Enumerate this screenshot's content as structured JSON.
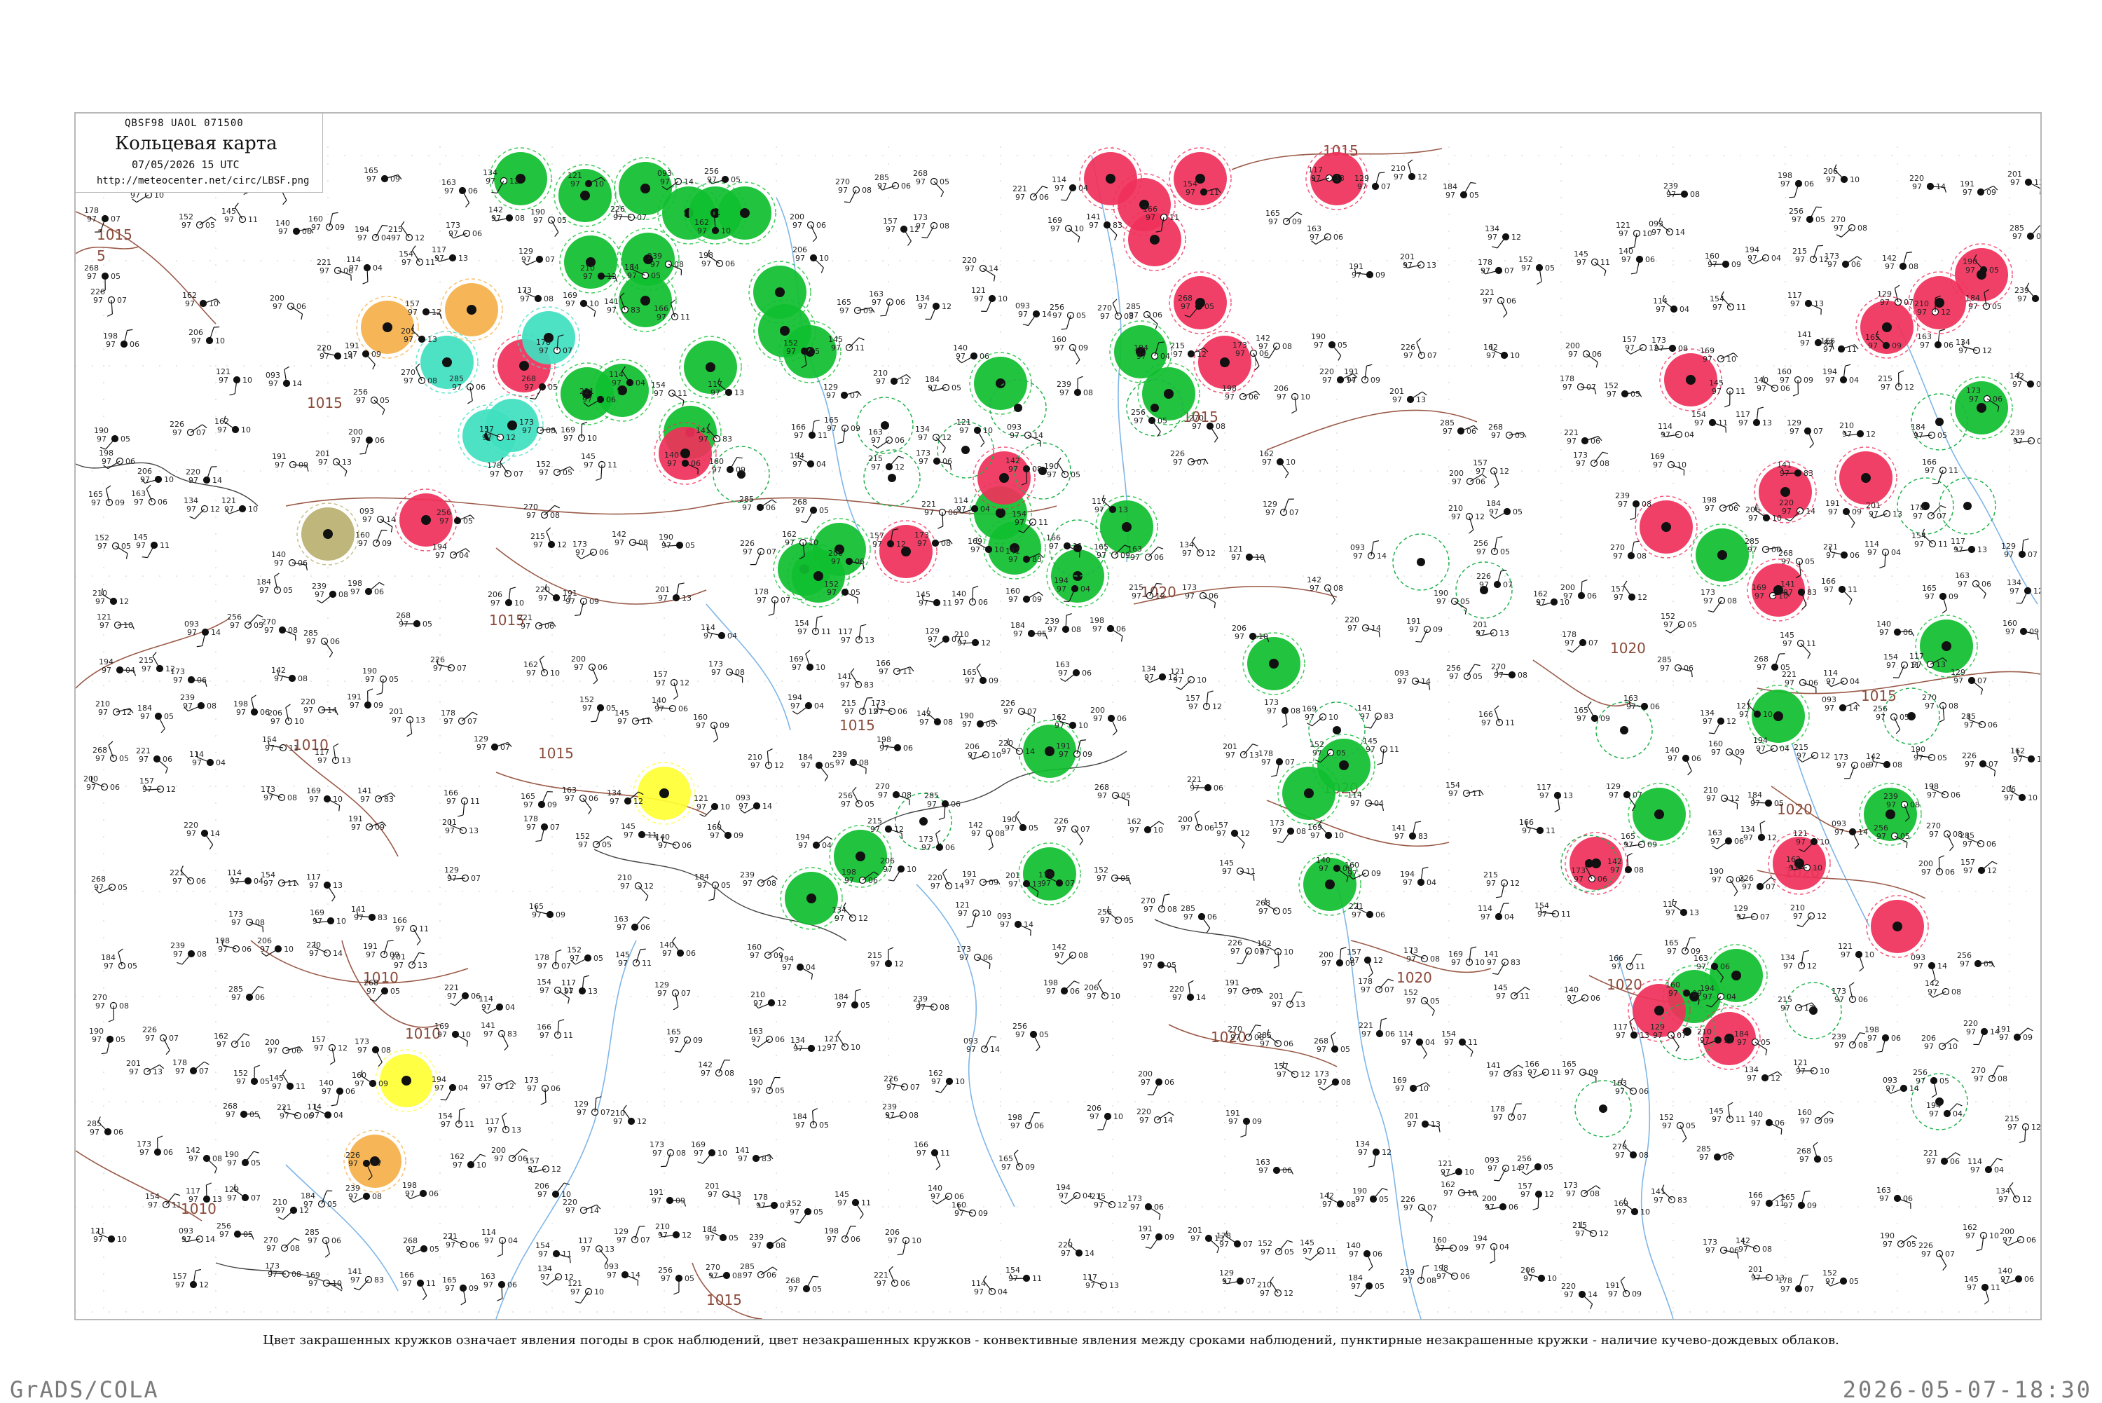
{
  "header": {
    "code": "QBSF98  UAOL  071500",
    "title": "Кольцевая карта",
    "date": "07/05/2026 15 UTC",
    "url": "http://meteocenter.net/circ/LBSF.png"
  },
  "caption": "Цвет закрашенных кружков означает явления погоды в срок наблюдений, цвет незакрашенных кружков - конвективные явления между сроками наблюдений, пунктирные незакрашенные кружки - наличие кучево-дождевых облаков.",
  "footer": {
    "left": "GrADS/COLA",
    "right": "2026-05-07-18:30"
  },
  "colors": {
    "rain_green": "#0fbf2f",
    "thunder_red": "#f0305a",
    "shower_orange": "#f5b04a",
    "fog_yellow": "#ffff33",
    "drizzle_teal": "#3fe0c0",
    "haze_olive": "#b8b070",
    "isobar_brown": "#9a5a48",
    "river_blue": "#7fb6e8",
    "coast_dark": "#444444"
  },
  "isobars": [
    "1015",
    "1015",
    "1015",
    "1015",
    "1015",
    "1015",
    "1015",
    "1015",
    "1010",
    "1010",
    "1010",
    "1010",
    "1020",
    "1020",
    "1020",
    "1020",
    "1020",
    "1020",
    "1020",
    "1020",
    "1015",
    "5"
  ],
  "stations": [
    {
      "t": "173",
      "p": "97",
      "d": "08"
    },
    {
      "t": "169",
      "p": "97",
      "d": "10"
    },
    {
      "t": "141",
      "p": "97",
      "d": "83"
    },
    {
      "t": "166",
      "p": "97",
      "d": "11"
    },
    {
      "t": "165",
      "p": "97",
      "d": "09"
    },
    {
      "t": "163",
      "p": "97",
      "d": "06"
    },
    {
      "t": "134",
      "p": "97",
      "d": "12"
    },
    {
      "t": "121",
      "p": "97",
      "d": "10"
    },
    {
      "t": "093",
      "p": "97",
      "d": "14"
    },
    {
      "t": "256",
      "p": "97",
      "d": "05"
    },
    {
      "t": "270",
      "p": "97",
      "d": "08"
    },
    {
      "t": "285",
      "p": "97",
      "d": "06"
    },
    {
      "t": "268",
      "p": "97",
      "d": "05"
    },
    {
      "t": "221",
      "p": "97",
      "d": "06"
    },
    {
      "t": "114",
      "p": "97",
      "d": "04"
    },
    {
      "t": "154",
      "p": "97",
      "d": "11"
    },
    {
      "t": "117",
      "p": "97",
      "d": "13"
    },
    {
      "t": "129",
      "p": "97",
      "d": "07"
    },
    {
      "t": "210",
      "p": "97",
      "d": "12"
    },
    {
      "t": "184",
      "p": "97",
      "d": "05"
    },
    {
      "t": "239",
      "p": "97",
      "d": "08"
    },
    {
      "t": "198",
      "p": "97",
      "d": "06"
    },
    {
      "t": "206",
      "p": "97",
      "d": "10"
    },
    {
      "t": "220",
      "p": "97",
      "d": "14"
    },
    {
      "t": "191",
      "p": "97",
      "d": "09"
    },
    {
      "t": "201",
      "p": "97",
      "d": "13"
    },
    {
      "t": "178",
      "p": "97",
      "d": "07"
    },
    {
      "t": "152",
      "p": "97",
      "d": "05"
    },
    {
      "t": "145",
      "p": "97",
      "d": "11"
    },
    {
      "t": "140",
      "p": "97",
      "d": "06"
    },
    {
      "t": "160",
      "p": "97",
      "d": "09"
    },
    {
      "t": "194",
      "p": "97",
      "d": "04"
    },
    {
      "t": "215",
      "p": "97",
      "d": "12"
    },
    {
      "t": "173",
      "p": "97",
      "d": "06"
    },
    {
      "t": "142",
      "p": "97",
      "d": "08"
    },
    {
      "t": "190",
      "p": "97",
      "d": "05"
    },
    {
      "t": "226",
      "p": "97",
      "d": "07"
    },
    {
      "t": "162",
      "p": "97",
      "d": "10"
    },
    {
      "t": "200",
      "p": "97",
      "d": "06"
    },
    {
      "t": "157",
      "p": "97",
      "d": "12"
    }
  ]
}
